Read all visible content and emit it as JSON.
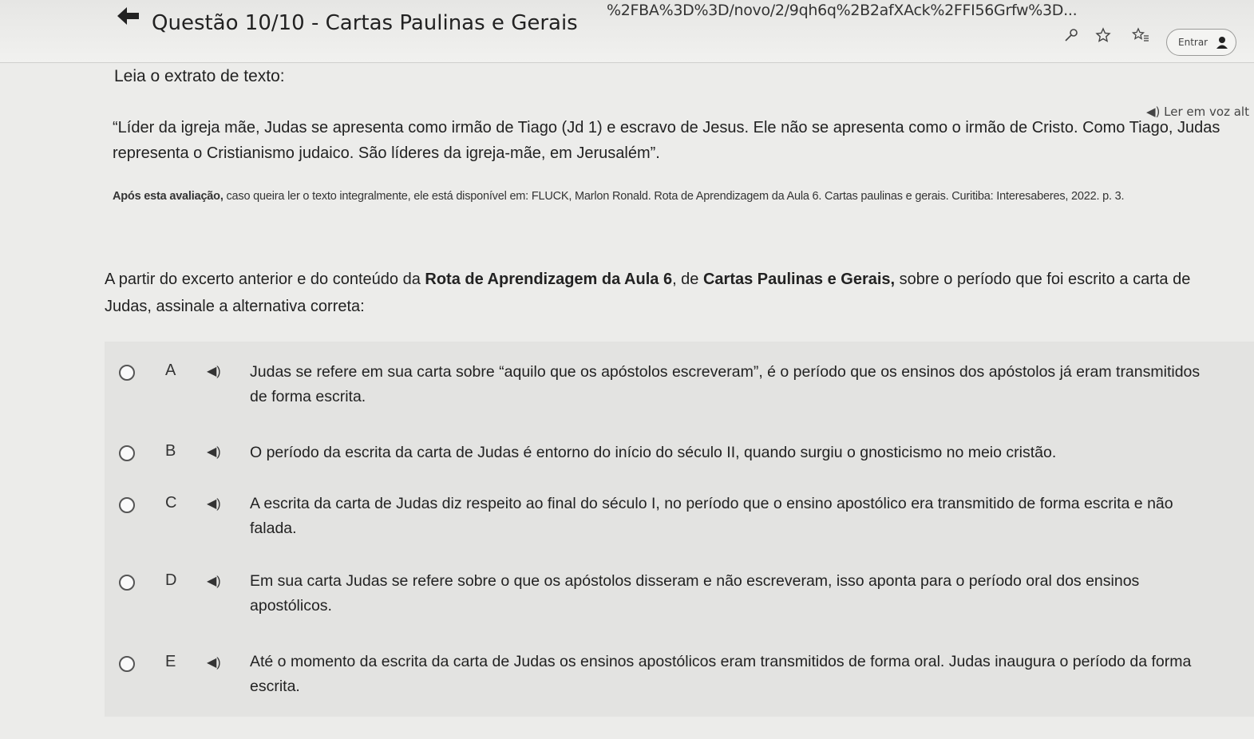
{
  "browser": {
    "url": "%2FBA%3D%3D/novo/2/9qh6q%2B2afXAck%2FFI56Grfw%3D...",
    "signin_label": "Entrar"
  },
  "header": {
    "back_icon": "back-arrow-icon",
    "title": "Questão 10/10 - Cartas Paulinas e Gerais"
  },
  "excerpt": {
    "label": "Leia o extrato de texto:",
    "voice_label": "Ler em voz alt",
    "quote_line1": "“Líder da igreja mãe, Judas se apresenta como irmão de Tiago (Jd 1) e escravo de Jesus. Ele não se apresenta como o irmão de Cristo. Como Tiago, Judas",
    "quote_line2": "representa o Cristianismo judaico. São líderes da igreja-mãe, em Jerusalém”.",
    "source_bold": "Após esta avaliação,",
    "source_rest": " caso queira ler o texto integralmente, ele está disponível em: FLUCK, Marlon Ronald. Rota de Aprendizagem da Aula 6. Cartas paulinas e gerais. Curitiba: Interesaberes, 2022. p. 3."
  },
  "question": {
    "part1": "A partir do excerto anterior e do conteúdo da ",
    "bold1": "Rota de Aprendizagem da Aula 6",
    "part2": ", de ",
    "bold2": "Cartas Paulinas e Gerais,",
    "part3": " sobre o período que foi escrito a carta de",
    "line2": "Judas, assinale a alternativa correta:"
  },
  "options": [
    {
      "letter": "A",
      "line1": "Judas se refere em sua carta sobre “aquilo que os apóstolos escreveram”, é o período que os ensinos dos apóstolos já eram transmitidos",
      "line2": "de forma escrita."
    },
    {
      "letter": "B",
      "line1": "O período da escrita da carta de Judas é entorno do início do século II, quando surgiu o gnosticismo no meio cristão.",
      "line2": ""
    },
    {
      "letter": "C",
      "line1": "A escrita da carta de Judas diz respeito ao final do século I, no período que o ensino apostólico era transmitido de forma escrita e não",
      "line2": "falada."
    },
    {
      "letter": "D",
      "line1": "Em sua carta Judas se refere sobre o que os apóstolos disseram e não escreveram, isso aponta para o período oral dos ensinos",
      "line2": "apostólicos."
    },
    {
      "letter": "E",
      "line1": "Até o momento da escrita da carta de Judas os ensinos apostólicos eram transmitidos de forma oral. Judas inaugura o período da forma",
      "line2": "escrita."
    }
  ]
}
